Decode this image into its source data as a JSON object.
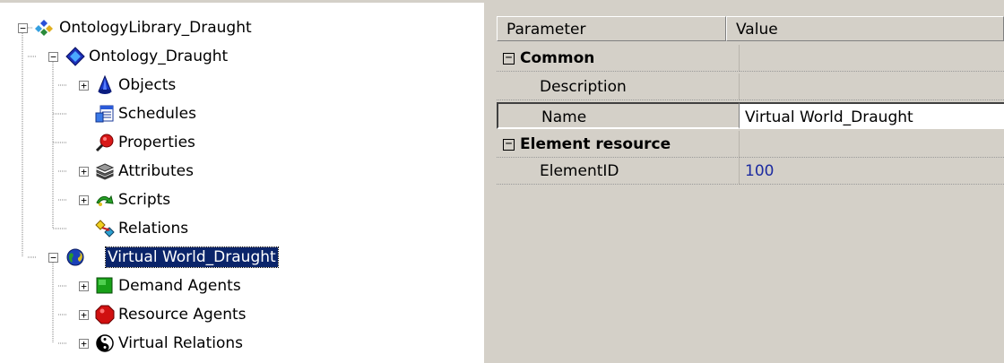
{
  "tree": {
    "root": {
      "label": "OntologyLibrary_Draught",
      "expander": "−",
      "icon": "ontology-library-icon"
    },
    "ontology": {
      "label": "Ontology_Draught",
      "expander": "−",
      "icon": "blue-diamond-icon",
      "children": [
        {
          "label": "Objects",
          "expander": "+",
          "icon": "blue-cone-icon"
        },
        {
          "label": "Schedules",
          "expander": "",
          "icon": "schedule-table-icon"
        },
        {
          "label": "Properties",
          "expander": "",
          "icon": "magnifier-icon"
        },
        {
          "label": "Attributes",
          "expander": "+",
          "icon": "stacked-layers-icon"
        },
        {
          "label": "Scripts",
          "expander": "+",
          "icon": "script-arrow-icon"
        },
        {
          "label": "Relations",
          "expander": "",
          "icon": "relations-icon"
        }
      ]
    },
    "world": {
      "label": "Virtual World_Draught",
      "expander": "−",
      "icon": "globe-icon",
      "children": [
        {
          "label": "Demand Agents",
          "expander": "+",
          "icon": "green-square-icon"
        },
        {
          "label": "Resource Agents",
          "expander": "+",
          "icon": "red-octagon-icon"
        },
        {
          "label": "Virtual Relations",
          "expander": "+",
          "icon": "yin-yang-icon"
        }
      ]
    }
  },
  "grid": {
    "headers": {
      "parameter": "Parameter",
      "value": "Value"
    },
    "rows": [
      {
        "type": "category",
        "label": "Common",
        "expander": "−"
      },
      {
        "type": "property",
        "label": "Description",
        "value": ""
      },
      {
        "type": "property",
        "label": "Name",
        "value": "Virtual World_Draught",
        "selected": true
      },
      {
        "type": "category",
        "label": "Element resource",
        "expander": "−"
      },
      {
        "type": "property",
        "label": "ElementID",
        "value": "100"
      }
    ]
  },
  "colors": {
    "selection": "#0a246a",
    "id_value": "#1c2ba0",
    "panel": "#d4d0c8"
  }
}
